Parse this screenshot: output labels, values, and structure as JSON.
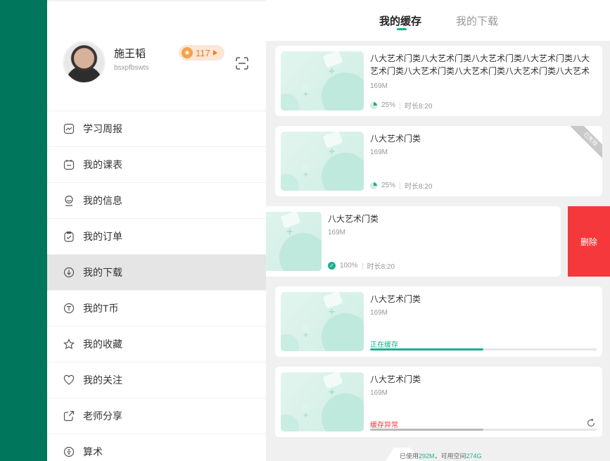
{
  "user": {
    "name": "施王韬",
    "id": "bsxpfbswts",
    "coins": "117"
  },
  "menu": [
    {
      "label": "学习周报",
      "icon": "chart-icon"
    },
    {
      "label": "我的课表",
      "icon": "calendar-icon"
    },
    {
      "label": "我的信息",
      "icon": "profile-icon"
    },
    {
      "label": "我的订单",
      "icon": "clipboard-icon"
    },
    {
      "label": "我的下载",
      "icon": "download-icon",
      "active": true
    },
    {
      "label": "我的T币",
      "icon": "coin-icon"
    },
    {
      "label": "我的收藏",
      "icon": "star-icon"
    },
    {
      "label": "我的关注",
      "icon": "heart-icon"
    },
    {
      "label": "老师分享",
      "icon": "share-icon"
    },
    {
      "label": "算术",
      "icon": "calculator-icon"
    }
  ],
  "tabs": {
    "cache": "我的缓存",
    "downloads": "我的下载"
  },
  "items": [
    {
      "title": "八大艺术门类八大艺术门类八大艺术门类八大艺术门类八大艺术门类八大艺术门类八大艺术门类八大艺术门类八大艺术门类...",
      "size": "169M",
      "progress": "25%",
      "duration": "时长8:20"
    },
    {
      "title": "八大艺术门类",
      "size": "169M",
      "progress": "25%",
      "duration": "时长8:20",
      "ribbon": "已失效"
    },
    {
      "title": "八大艺术门类",
      "size": "169M",
      "progress": "100%",
      "duration": "时长8:20",
      "delete_label": "删除"
    },
    {
      "title": "八大艺术门类",
      "size": "169M",
      "status": "正在缓存",
      "status_color": "#1ab190",
      "fraction": 0.5
    },
    {
      "title": "八大艺术门类",
      "size": "169M",
      "status": "缓存异常",
      "status_color": "#f5383b",
      "fraction": 0.5
    }
  ],
  "storage": {
    "used_label": "已使用",
    "used": "292M",
    "free_label": "，可用空间",
    "free": "274G"
  },
  "colors": {
    "brand": "#00765c",
    "accent": "#1ab190",
    "danger": "#f5383b",
    "coin": "#f07b2c"
  }
}
